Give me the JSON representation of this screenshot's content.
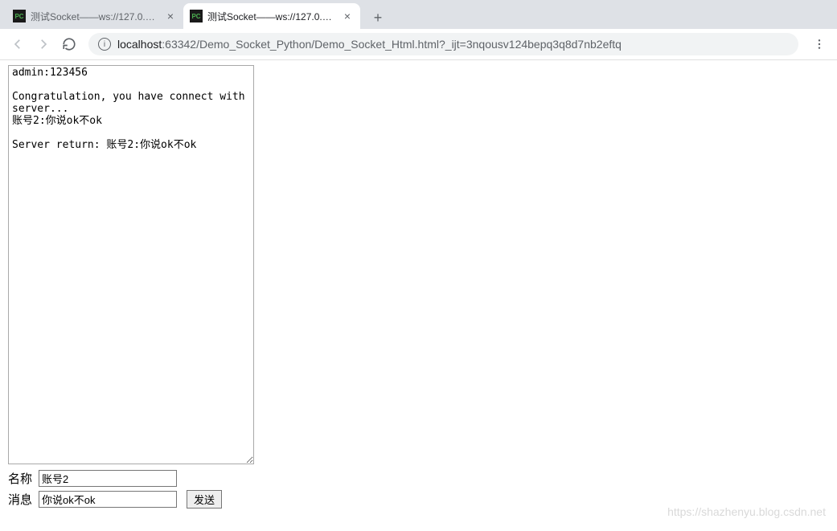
{
  "browser": {
    "tabs": [
      {
        "favicon": "PC",
        "title": "测试Socket——ws://127.0.0.1:8",
        "active": false
      },
      {
        "favicon": "PC",
        "title": "测试Socket——ws://127.0.0.1:8",
        "active": true
      }
    ],
    "new_tab": "+",
    "url_host": "localhost",
    "url_path": ":63342/Demo_Socket_Python/Demo_Socket_Html.html?_ijt=3nqousv124bepq3q8d7nb2eftq"
  },
  "page": {
    "log_text": "admin:123456\n\nCongratulation, you have connect with server...\n账号2:你说ok不ok\n\nServer return: 账号2:你说ok不ok",
    "labels": {
      "name": "名称",
      "message": "消息"
    },
    "inputs": {
      "name_value": "账号2",
      "message_value": "你说ok不ok"
    },
    "send_label": "发送"
  },
  "watermark": "https://shazhenyu.blog.csdn.net"
}
